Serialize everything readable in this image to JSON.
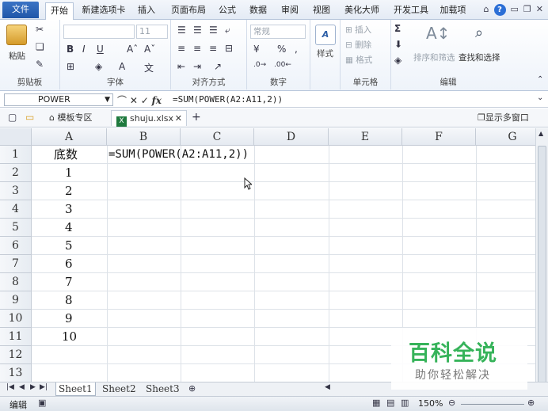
{
  "ribbon_tabs": [
    "文件",
    "开始",
    "新建选项卡",
    "插入",
    "页面布局",
    "公式",
    "数据",
    "审阅",
    "视图",
    "美化大师",
    "开发工具",
    "加载项"
  ],
  "ribbon": {
    "clipboard": {
      "paste": "粘贴",
      "label": "剪贴板"
    },
    "font": {
      "size": "11",
      "label": "字体"
    },
    "alignment": {
      "label": "对齐方式"
    },
    "number": {
      "format": "常规",
      "percent": "%",
      "comma": ",",
      "label": "数字"
    },
    "styles": {
      "label": "样式"
    },
    "cells": {
      "insert": "插入",
      "delete": "删除",
      "format": "格式",
      "label": "单元格"
    },
    "editing": {
      "sort": "排序和筛选",
      "find": "查找和选择",
      "label": "编辑"
    }
  },
  "formula_bar": {
    "name_box": "POWER",
    "formula": "=SUM(POWER(A2:A11,2))"
  },
  "doc_tabs": {
    "template": "模板专区",
    "file": "shuju.xlsx",
    "show_multi": "显示多窗口"
  },
  "columns": [
    "A",
    "B",
    "C",
    "D",
    "E",
    "F",
    "G"
  ],
  "rows": [
    "1",
    "2",
    "3",
    "4",
    "5",
    "6",
    "7",
    "8",
    "9",
    "10",
    "11",
    "12",
    "13"
  ],
  "cells": {
    "A1": "底数",
    "B1": "=SUM(POWER(A2:A11,2))",
    "A_values": [
      "1",
      "2",
      "3",
      "4",
      "5",
      "6",
      "7",
      "8",
      "9",
      "10"
    ]
  },
  "sheets": [
    "Sheet1",
    "Sheet2",
    "Sheet3"
  ],
  "status": {
    "mode": "编辑",
    "zoom": "150%"
  },
  "watermark": {
    "brand": "百科全说",
    "slogan": "助你轻松解决"
  }
}
